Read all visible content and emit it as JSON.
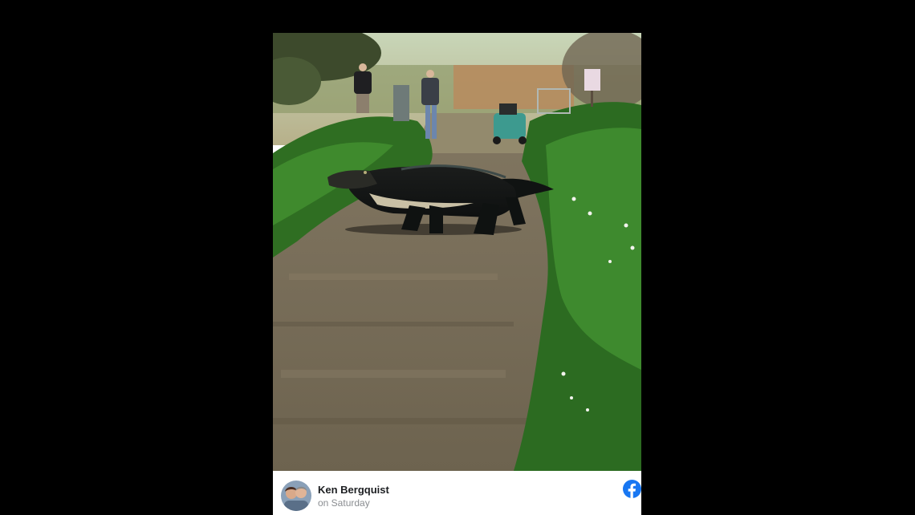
{
  "post": {
    "author_name": "Ken Bergquist",
    "timestamp": "on Saturday",
    "avatar_icon": "profile-photo-avatar",
    "platform_icon": "facebook-icon",
    "platform_color": "#1877F2"
  },
  "photo": {
    "subject": "alligator-crossing-trail-photo"
  }
}
